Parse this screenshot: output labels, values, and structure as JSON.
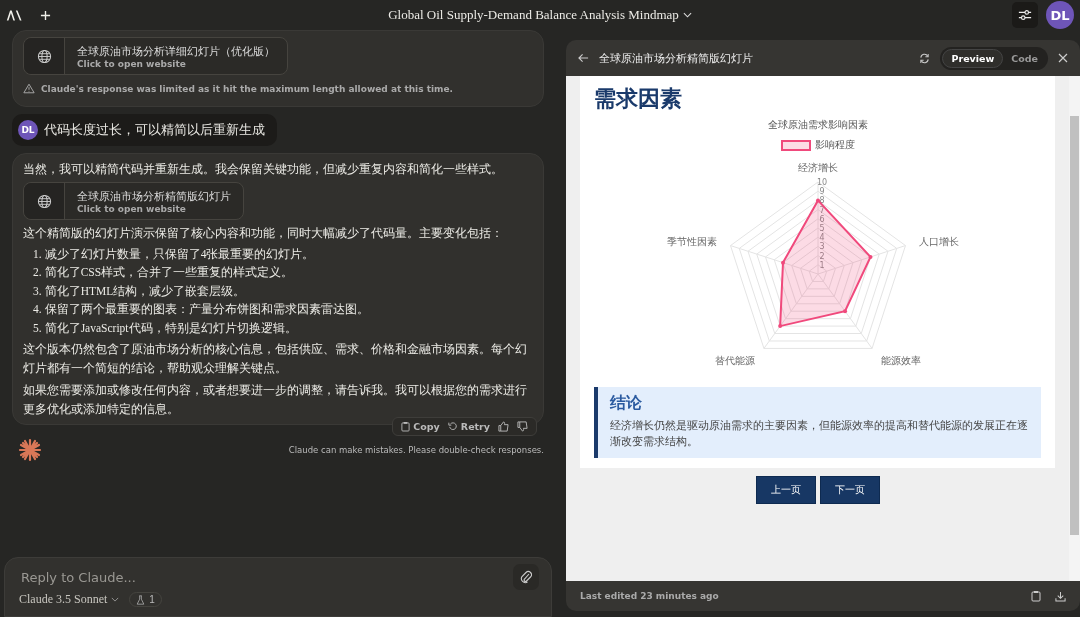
{
  "app_bar": {
    "title": "Global Oil Supply-Demand Balance Analysis Mindmap",
    "avatar": "DL"
  },
  "chat": {
    "messages": [
      {
        "kind": "assistant",
        "blocks": [
          {
            "kind": "artifact",
            "title": "全球原油市场分析详细幻灯片（优化版）",
            "subtitle": "Click to open website"
          },
          {
            "kind": "notice",
            "text": "Claude's response was limited as it hit the maximum length allowed at this time."
          }
        ]
      },
      {
        "kind": "user",
        "avatar": "DL",
        "text": "代码长度过长，可以精简以后重新生成"
      },
      {
        "kind": "assistant",
        "blocks": [
          {
            "kind": "paragraph",
            "text": "当然，我可以精简代码并重新生成。我会保留关键功能，但减少重复内容和简化一些样式。"
          },
          {
            "kind": "artifact",
            "title": "全球原油市场分析精简版幻灯片",
            "subtitle": "Click to open website"
          },
          {
            "kind": "paragraph",
            "text": "这个精简版的幻灯片演示保留了核心内容和功能，同时大幅减少了代码量。主要变化包括："
          },
          {
            "kind": "list",
            "items": [
              {
                "number": "1.",
                "text": "减少了幻灯片数量，只保留了4张最重要的幻灯片。"
              },
              {
                "number": "2.",
                "text": "简化了CSS样式，合并了一些重复的样式定义。"
              },
              {
                "number": "3.",
                "text": "简化了HTML结构，减少了嵌套层级。"
              },
              {
                "number": "4.",
                "text": "保留了两个最重要的图表：产量分布饼图和需求因素雷达图。"
              },
              {
                "number": "5.",
                "text": "简化了JavaScript代码，特别是幻灯片切换逻辑。"
              }
            ]
          },
          {
            "kind": "paragraph",
            "text": "这个版本仍然包含了原油市场分析的核心信息，包括供应、需求、价格和金融市场因素。每个幻灯片都有一个简短的结论，帮助观众理解关键点。"
          },
          {
            "kind": "paragraph",
            "text": "如果您需要添加或修改任何内容，或者想要进一步的调整，请告诉我。我可以根据您的需求进行更多优化或添加特定的信息。"
          }
        ],
        "actions": [
          "Copy",
          "Retry"
        ]
      }
    ],
    "disclaimer": "Claude can make mistakes. Please double-check responses.",
    "composer": {
      "placeholder": "Reply to Claude...",
      "model": "Claude 3.5 Sonnet",
      "count": "1"
    }
  },
  "artifact_panel": {
    "title": "全球原油市场分析精简版幻灯片",
    "tabs": [
      {
        "label": "Preview",
        "selected": true
      },
      {
        "label": "Code",
        "selected": false
      }
    ],
    "slide": {
      "heading": "需求因素",
      "chart_data": {
        "type": "radar",
        "title": "全球原油需求影响因素",
        "categories": [
          "经济增长",
          "人口增长",
          "能源效率",
          "替代能源",
          "季节性因素"
        ],
        "series": [
          {
            "name": "影响程度",
            "color": "#f0497c",
            "values": [
              8,
              6,
              5,
              7,
              4
            ]
          }
        ],
        "ylim": [
          0,
          10
        ],
        "yticks": [
          1,
          2,
          3,
          4,
          5,
          6,
          7,
          8,
          9,
          10
        ]
      },
      "conclusion": {
        "title": "结论",
        "text": "经济增长仍然是驱动原油需求的主要因素，但能源效率的提高和替代能源的发展正在逐渐改变需求结构。"
      },
      "buttons": [
        "上一页",
        "下一页"
      ]
    },
    "footer": "Last edited 23 minutes ago"
  }
}
